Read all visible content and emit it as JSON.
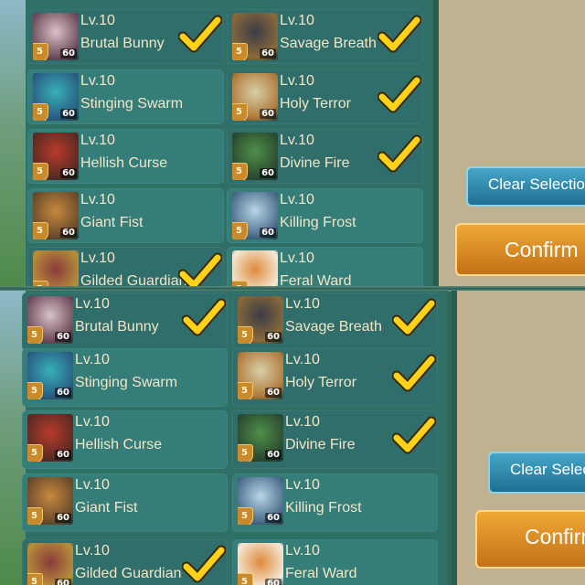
{
  "panels": [
    {
      "cards": [
        {
          "level": "Lv.10",
          "name": "Brutal Bunny",
          "stars": "60",
          "selected": true
        },
        {
          "level": "Lv.10",
          "name": "Savage Breath",
          "stars": "60",
          "selected": true
        },
        {
          "level": "Lv.10",
          "name": "Stinging Swarm",
          "stars": "60",
          "selected": false
        },
        {
          "level": "Lv.10",
          "name": "Holy Terror",
          "stars": "60",
          "selected": true
        },
        {
          "level": "Lv.10",
          "name": "Hellish Curse",
          "stars": "60",
          "selected": false
        },
        {
          "level": "Lv.10",
          "name": "Divine Fire",
          "stars": "60",
          "selected": true
        },
        {
          "level": "Lv.10",
          "name": "Giant Fist",
          "stars": "60",
          "selected": false
        },
        {
          "level": "Lv.10",
          "name": "Killing Frost",
          "stars": "60",
          "selected": false
        },
        {
          "level": "Lv.10",
          "name": "Gilded Guardian",
          "stars": "60",
          "selected": true
        },
        {
          "level": "Lv.10",
          "name": "Feral Ward",
          "stars": "60",
          "selected": false
        }
      ],
      "buttons": {
        "clear": "Clear Selection",
        "confirm": "Confirm"
      }
    },
    {
      "cards": [
        {
          "level": "Lv.10",
          "name": "Brutal Bunny",
          "stars": "60",
          "selected": true
        },
        {
          "level": "Lv.10",
          "name": "Savage Breath",
          "stars": "60",
          "selected": true
        },
        {
          "level": "Lv.10",
          "name": "Stinging Swarm",
          "stars": "60",
          "selected": false
        },
        {
          "level": "Lv.10",
          "name": "Holy Terror",
          "stars": "60",
          "selected": true
        },
        {
          "level": "Lv.10",
          "name": "Hellish Curse",
          "stars": "60",
          "selected": false
        },
        {
          "level": "Lv.10",
          "name": "Divine Fire",
          "stars": "60",
          "selected": true
        },
        {
          "level": "Lv.10",
          "name": "Giant Fist",
          "stars": "60",
          "selected": false
        },
        {
          "level": "Lv.10",
          "name": "Killing Frost",
          "stars": "60",
          "selected": false
        },
        {
          "level": "Lv.10",
          "name": "Gilded Guardian",
          "stars": "60",
          "selected": true
        },
        {
          "level": "Lv.10",
          "name": "Feral Ward",
          "stars": "60",
          "selected": false
        }
      ],
      "buttons": {
        "clear": "Clear Selection",
        "confirm": "Confirm"
      }
    }
  ],
  "shield_label": "5",
  "colors": {
    "card": "#347d79",
    "check": "#ffd21a",
    "clear_button": "#2a86ab",
    "confirm_button": "#e08f24",
    "side_panel": "#c0b291"
  },
  "icons": {
    "selected_mark": "checkmark-icon",
    "rarity_badge": "shield-icon"
  }
}
